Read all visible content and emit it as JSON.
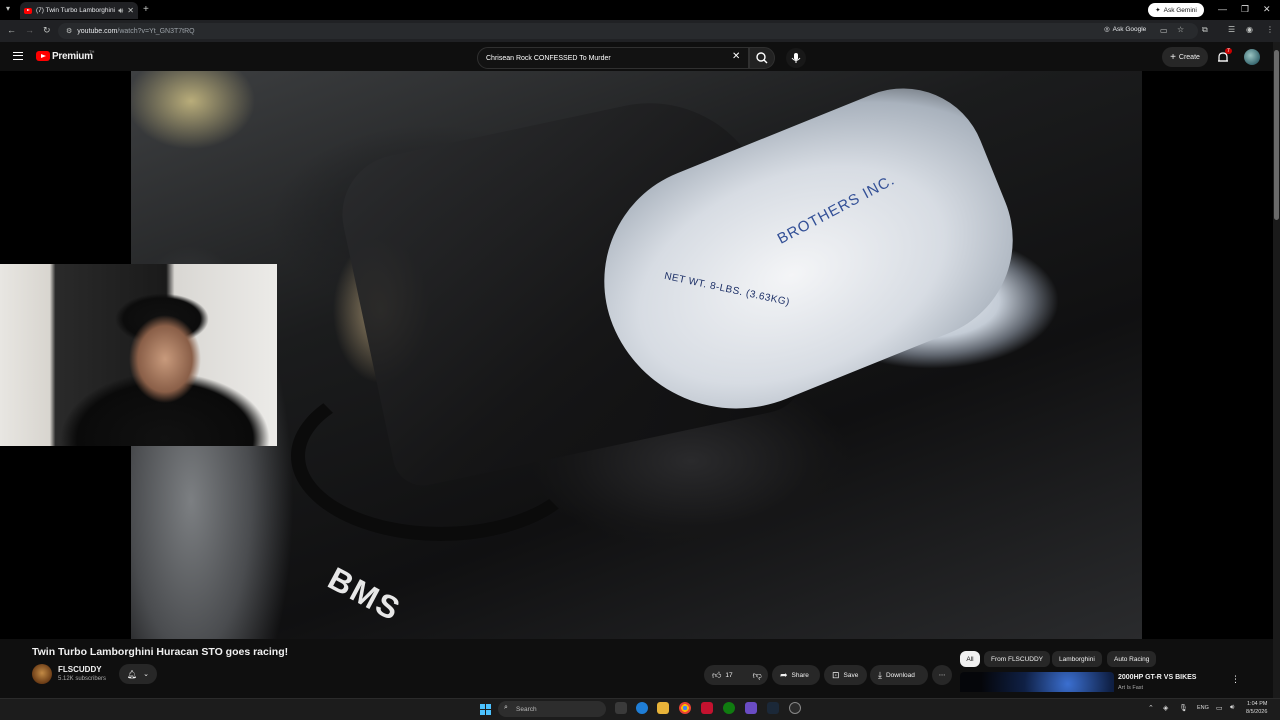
{
  "browser": {
    "tab_title": "(7) Twin Turbo Lamborghini",
    "new_tab": "+",
    "ask_gemini": "Ask Gemini",
    "url_host": "youtube.com",
    "url_path": "/watch?v=Yt_GN3T7tRQ",
    "ask_google": "Ask Google",
    "window_controls": [
      "—",
      "❐",
      "✕"
    ]
  },
  "youtube": {
    "logo_text": "Premium",
    "logo_country": "TH",
    "search_query": "Chrisean Rock CONFESSED To Murder",
    "create_label": "Create",
    "notification_count": "7"
  },
  "video": {
    "bag_brand": "BROTHERS INC.",
    "bag_weight": "NET WT. 8-LBS. (3.63KG)",
    "car_text": "BMS",
    "title": "Twin Turbo Lamborghini Huracan STO goes racing!",
    "channel_name": "FLSCUDDY",
    "subscribers": "5.12K subscribers",
    "like_count": "17",
    "share_label": "Share",
    "save_label": "Save",
    "download_label": "Download",
    "more_label": "⋯"
  },
  "chips": [
    "All",
    "From FLSCUDDY",
    "Lamborghini",
    "Auto Racing"
  ],
  "recommendation": {
    "title": "2000HP GT-R VS BIKES",
    "channel": "Art Is Fast"
  },
  "taskbar": {
    "search_placeholder": "Search",
    "language": "ENG",
    "time": "1:04 PM",
    "date": "8/5/2026"
  },
  "colors": {
    "youtube_red": "#ff0000",
    "background": "#0f0f0f",
    "pill": "#272727",
    "windows_accent": "#4cc2ff"
  }
}
